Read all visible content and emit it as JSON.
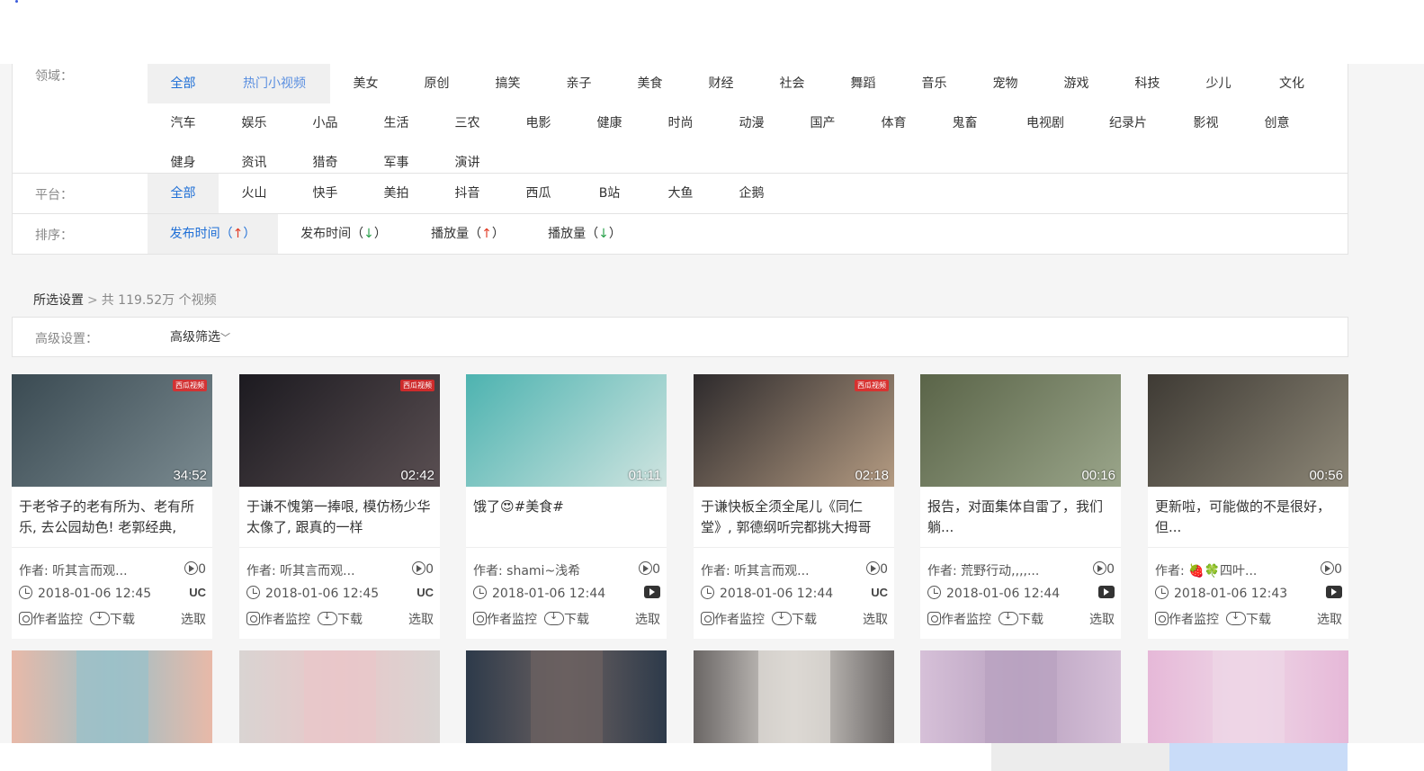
{
  "filters": {
    "domain_label": "领域：",
    "domain_items": [
      "全部",
      "热门小视频",
      "美女",
      "原创",
      "搞笑",
      "亲子",
      "美食",
      "财经",
      "社会",
      "舞蹈",
      "音乐",
      "宠物",
      "游戏",
      "科技",
      "少儿",
      "文化",
      "汽车",
      "娱乐",
      "小品",
      "生活",
      "三农",
      "电影",
      "健康",
      "时尚",
      "动漫",
      "国产",
      "体育",
      "鬼畜",
      "电视剧",
      "纪录片",
      "影视",
      "创意",
      "健身",
      "资讯",
      "猎奇",
      "军事",
      "演讲"
    ],
    "platform_label": "平台：",
    "platform_items": [
      "全部",
      "火山",
      "快手",
      "美拍",
      "抖音",
      "西瓜",
      "B站",
      "大鱼",
      "企鹅"
    ],
    "sort_label": "排序：",
    "sort_items": [
      {
        "label": "发布时间（",
        "arrow": "↑",
        "close": "）"
      },
      {
        "label": "发布时间（",
        "arrow": "↓",
        "close": "）"
      },
      {
        "label": "播放量（",
        "arrow": "↑",
        "close": "）"
      },
      {
        "label": "播放量（",
        "arrow": "↓",
        "close": "）"
      }
    ]
  },
  "summary": {
    "selected": "所选设置",
    "sep": ">",
    "count": "共 119.52万 个视频"
  },
  "advanced": {
    "label": "高级设置：",
    "button": "高级筛选",
    "chevron": "﹀"
  },
  "labels": {
    "monitor": "作者监控",
    "download": "下载",
    "select": "选取"
  },
  "cards": [
    {
      "duration": "34:52",
      "title": "于老爷子的老有所为、老有所乐, 去公园劫色! 老郭经典,",
      "author": "作者: 听其言而观...",
      "plays": "0",
      "date": "2018-01-06 12:45",
      "source": "UC",
      "badge": "西瓜视频",
      "colors": [
        "#3a4a52",
        "#7a8a90"
      ]
    },
    {
      "duration": "02:42",
      "title": "于谦不愧第一捧哏, 模仿杨少华太像了, 跟真的一样",
      "author": "作者: 听其言而观...",
      "plays": "0",
      "date": "2018-01-06 12:45",
      "source": "UC",
      "badge": "西瓜视频",
      "colors": [
        "#1c1a20",
        "#5a4f52"
      ]
    },
    {
      "duration": "01:11",
      "title": "饿了😍#美食#",
      "author": "作者: shami~浅希",
      "plays": "0",
      "date": "2018-01-06 12:44",
      "source": "cam",
      "badge": "",
      "colors": [
        "#4db3b0",
        "#cfe4e0"
      ]
    },
    {
      "duration": "02:18",
      "title": "于谦快板全须全尾儿《同仁堂》, 郭德纲听完都挑大拇哥",
      "author": "作者: 听其言而观...",
      "plays": "0",
      "date": "2018-01-06 12:44",
      "source": "UC",
      "badge": "西瓜视频",
      "colors": [
        "#2d2a2c",
        "#b49b82"
      ]
    },
    {
      "duration": "00:16",
      "title": "报告，对面集体自雷了，我们躺...",
      "author": "作者: 荒野行动,,,,...",
      "plays": "0",
      "date": "2018-01-06 12:44",
      "source": "cam",
      "badge": "",
      "colors": [
        "#5a6448",
        "#9aa58a"
      ]
    },
    {
      "duration": "00:56",
      "title": "更新啦，可能做的不是很好，但...",
      "author": "作者: 🍓🍀四叶...",
      "plays": "0",
      "date": "2018-01-06 12:43",
      "source": "cam",
      "badge": "",
      "colors": [
        "#3e3a34",
        "#8c8676"
      ]
    }
  ],
  "row2_colors": [
    [
      "#e8b9a8",
      "#9cc0c8"
    ],
    [
      "#d9d4d2",
      "#e9c7c9"
    ],
    [
      "#2d3a4a",
      "#6a6060"
    ],
    [
      "#6a6665",
      "#dcd8d3"
    ],
    [
      "#d6c0d8",
      "#b9a2c0"
    ],
    [
      "#e6b8d8",
      "#eed6e6"
    ]
  ]
}
